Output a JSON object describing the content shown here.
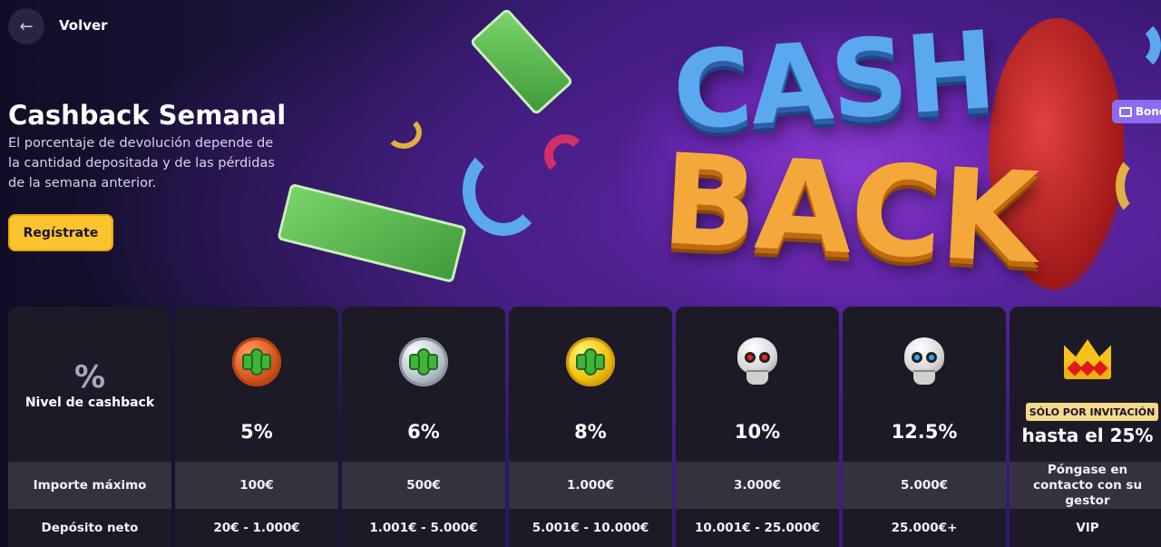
{
  "nav": {
    "back_label": "Volver"
  },
  "hero": {
    "title": "Cashback Semanal",
    "description": "El porcentaje de devolución depende de la cantidad depositada y de las pérdidas de la semana anterior.",
    "cta_label": "Regístrate",
    "art_word_top": "CASH",
    "art_word_bottom": "BACK",
    "bonus_tag": "Bono"
  },
  "table": {
    "header": {
      "icon": "%",
      "label": "Nivel de cashback"
    },
    "row_labels": {
      "max_amount": "Importe máximo",
      "net_deposit": "Depósito neto"
    },
    "tiers": [
      {
        "icon": "bronze-cactus-coin-icon",
        "percent": "5%",
        "max_amount": "100€",
        "net_deposit": "20€ - 1.000€"
      },
      {
        "icon": "silver-cactus-coin-icon",
        "percent": "6%",
        "max_amount": "500€",
        "net_deposit": "1.001€ - 5.000€"
      },
      {
        "icon": "gold-cactus-coin-icon",
        "percent": "8%",
        "max_amount": "1.000€",
        "net_deposit": "5.001€ - 10.000€"
      },
      {
        "icon": "red-eye-skull-icon",
        "percent": "10%",
        "max_amount": "3.000€",
        "net_deposit": "10.001€ - 25.000€"
      },
      {
        "icon": "blue-eye-skull-icon",
        "percent": "12.5%",
        "max_amount": "5.000€",
        "net_deposit": "25.000€+"
      }
    ],
    "vip": {
      "icon": "crown-icon",
      "badge": "SÓLO POR INVITACIÓN",
      "percent": "hasta el 25%",
      "max_amount": "Póngase en contacto con su gestor",
      "net_deposit": "VIP"
    }
  },
  "colors": {
    "accent_yellow": "#fbc42c",
    "vip_gold": "#f3d98a",
    "card_bg": "#1c1a26",
    "row_bg": "#34323e"
  }
}
